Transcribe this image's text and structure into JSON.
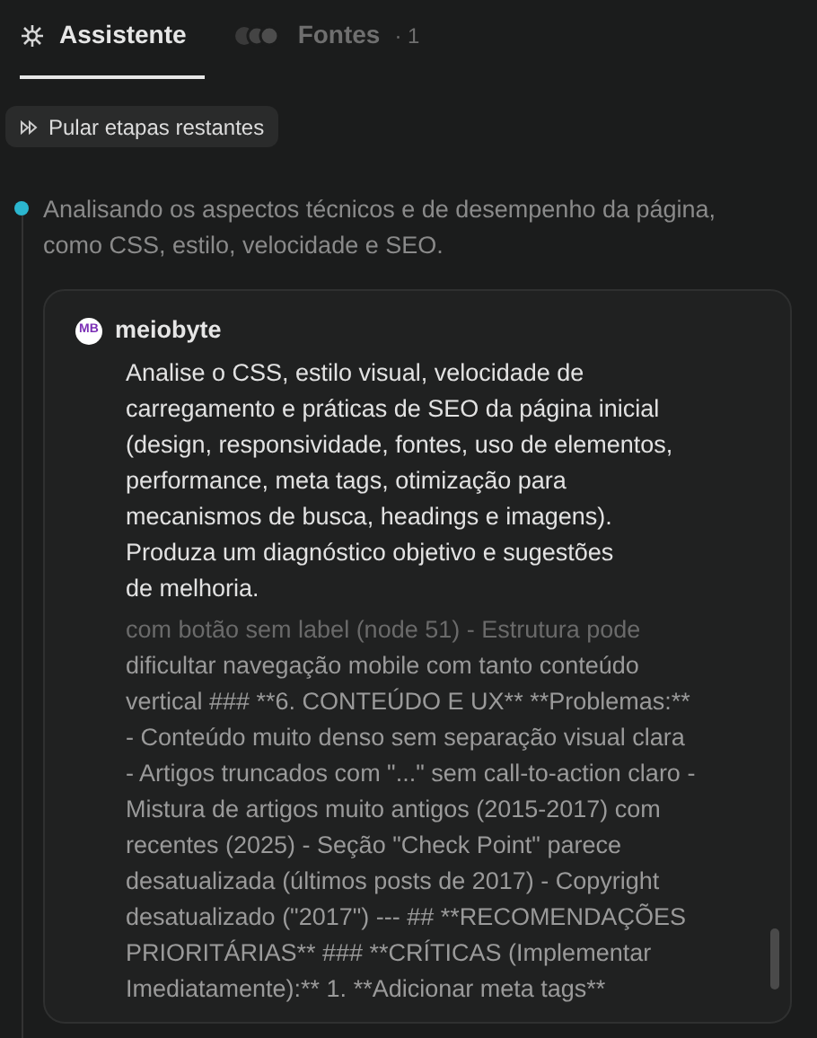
{
  "tabs": [
    {
      "label": "Assistente",
      "selected": true,
      "kind": "assistant"
    },
    {
      "label": "Fontes",
      "count": "· 1",
      "selected": false,
      "kind": "sources"
    }
  ],
  "skip_button": {
    "label": "Pular etapas restantes"
  },
  "step": {
    "text": "Analisando os aspectos técnicos e de desempenho da página, como CSS, estilo, velocidade e SEO."
  },
  "message": {
    "author": "meiobyte",
    "avatar": "MB",
    "prompt_lines": [
      "Analise o CSS, estilo visual, velocidade de",
      "carregamento e práticas de SEO da página inicial",
      "(design, responsividade, fontes, uso de elementos,",
      "performance, meta tags, otimização para",
      "mecanismos de busca, headings e imagens).",
      "Produza um diagnóstico objetivo e sugestões",
      "de melhoria."
    ],
    "output_lines": [
      "com botão sem label (node 51) - Estrutura pode",
      "dificultar navegação mobile com tanto conteúdo",
      "vertical ### **6. CONTEÚDO E UX** **Problemas:**",
      "- Conteúdo muito denso sem separação visual clara",
      "- Artigos truncados com \"...\" sem call-to-action claro -",
      "Mistura de artigos muito antigos (2015-2017) com",
      "recentes (2025) - Seção \"Check Point\" parece",
      "desatualizada (últimos posts de 2017) - Copyright",
      "desatualizado (\"2017\") --- ## **RECOMENDAÇÕES",
      "PRIORITÁRIAS** ### **CRÍTICAS (Implementar",
      "Imediatamente):** 1. **Adicionar meta tags**"
    ]
  }
}
